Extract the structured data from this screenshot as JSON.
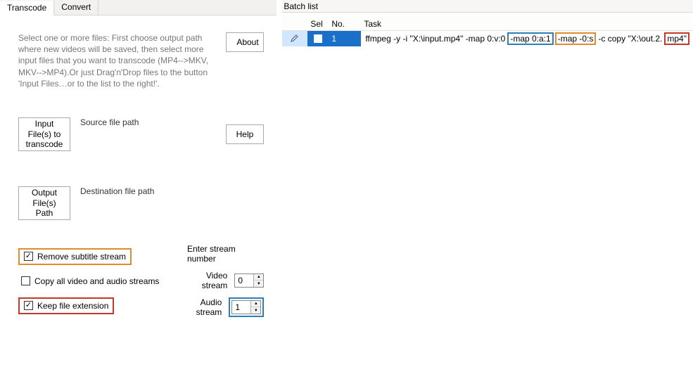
{
  "tabs": {
    "transcode": "Transcode",
    "convert": "Convert"
  },
  "intro": "Select one or more files: First choose output path where new videos will be saved, then select more input files that you want to transcode (MP4-->MKV, MKV-->MP4).Or just Drag'n'Drop files to the button 'Input Files…or to the list to the right!'.",
  "buttons": {
    "about": "About",
    "help": "Help",
    "input_files": "Input File(s) to transcode",
    "output_path": "Output File(s) Path"
  },
  "labels": {
    "source_path": "Source file path",
    "dest_path": "Destination file path",
    "remove_sub": "Remove subtitle stream",
    "copy_all": "Copy all video and audio streams",
    "keep_ext": "Keep file extension",
    "enter_stream": "Enter stream number",
    "video_stream": "Video stream",
    "audio_stream": "Audio stream"
  },
  "streams": {
    "video": "0",
    "audio": "1"
  },
  "batch": {
    "title": "Batch list",
    "cols": {
      "sel": "Sel",
      "no": "No.",
      "task": "Task"
    },
    "row": {
      "no": "1",
      "task_parts": {
        "p1": "ffmpeg -y -i \"X:\\input.mp4\"  -map 0:v:0",
        "p2": "-map 0:a:1",
        "p3": "-map -0:s",
        "p4": "-c copy \"X:\\out.2.",
        "p5": "mp4\""
      }
    }
  }
}
